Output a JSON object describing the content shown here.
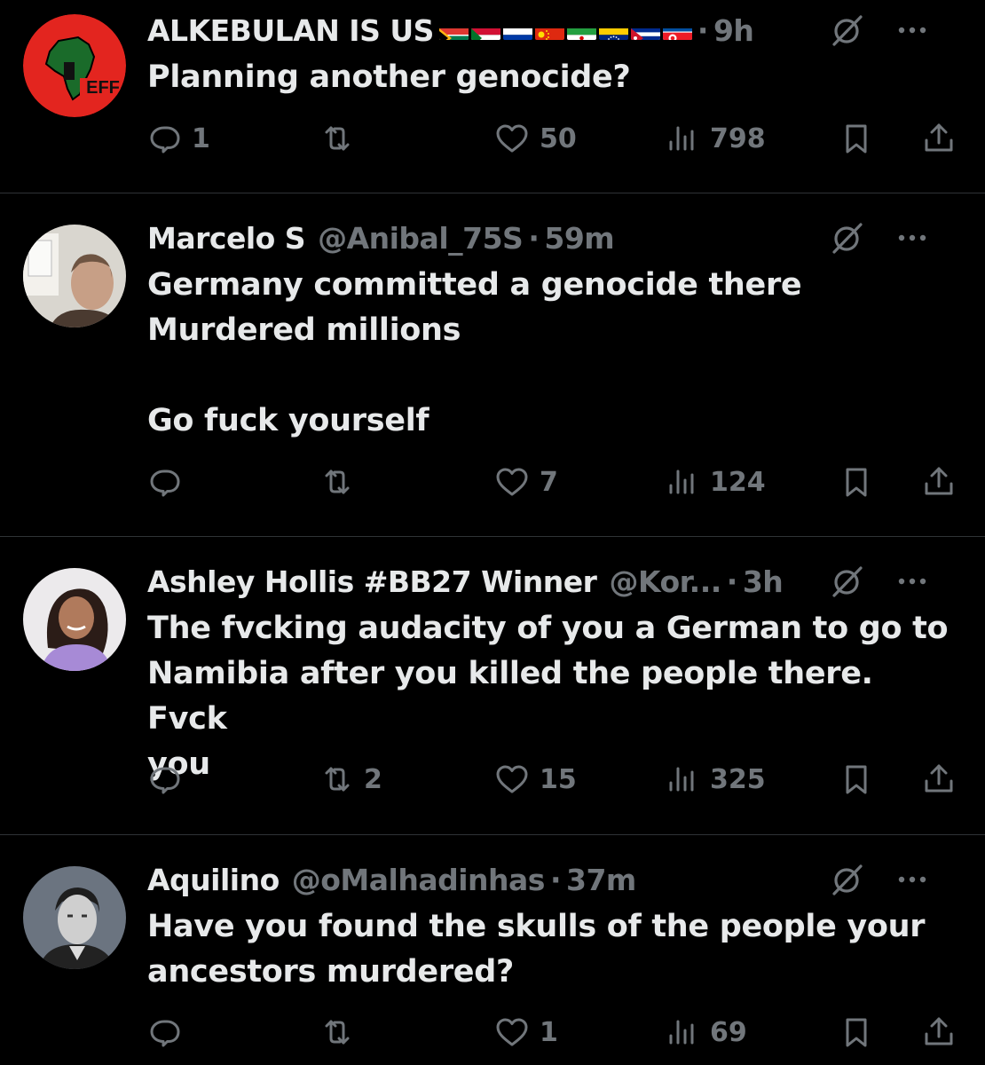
{
  "tweets": [
    {
      "name": "ALKEBULAN IS US",
      "handle": "",
      "time": "9h",
      "text": "Planning another genocide?",
      "replies": "1",
      "reposts": "",
      "likes": "50",
      "views": "798",
      "avatar_label": "EFF"
    },
    {
      "name": "Marcelo S",
      "handle": "@Anibal_75S",
      "time": "59m",
      "text": "Germany committed a genocide there\nMurdered millions\n\nGo fuck yourself",
      "replies": "",
      "reposts": "",
      "likes": "7",
      "views": "124"
    },
    {
      "name": "Ashley Hollis #BB27 Winner",
      "handle": "@Kor...",
      "time": "3h",
      "text": "The fvcking audacity of you a German to go to\nNamibia after you killed the people there. Fvck\nyou",
      "replies": "",
      "reposts": "2",
      "likes": "15",
      "views": "325"
    },
    {
      "name": "Aquilino",
      "handle": "@oMalhadinhas",
      "time": "37m",
      "text": "Have you found the skulls of the people your\nancestors murdered?",
      "replies": "",
      "reposts": "",
      "likes": "1",
      "views": "69"
    }
  ],
  "flags": [
    "south-africa",
    "sudan",
    "russia",
    "china",
    "iran",
    "venezuela",
    "cuba",
    "north-korea"
  ],
  "dot": "·",
  "colors": {
    "background": "#000000",
    "text": "#e7e9ea",
    "muted": "#71767b",
    "divider": "#2f3336",
    "eff_red": "#e3251f"
  },
  "icons": [
    "reply-icon",
    "repost-icon",
    "like-icon",
    "views-icon",
    "bookmark-icon",
    "share-icon",
    "grok-icon",
    "more-icon"
  ]
}
